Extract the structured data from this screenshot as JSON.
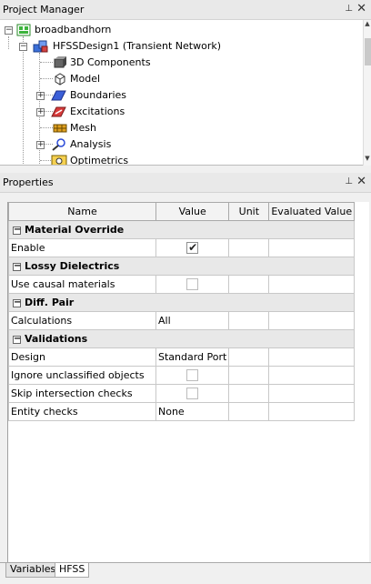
{
  "project_manager": {
    "title": "Project Manager",
    "pin_glyph": "ᵖ",
    "close_glyph": "✕",
    "tree": {
      "root": "broadbandhorn",
      "design": "HFSSDesign1 (Transient Network)",
      "children": [
        {
          "label": "3D Components",
          "icon": "components-icon"
        },
        {
          "label": "Model",
          "icon": "model-icon"
        },
        {
          "label": "Boundaries",
          "icon": "boundaries-icon"
        },
        {
          "label": "Excitations",
          "icon": "excitations-icon"
        },
        {
          "label": "Mesh",
          "icon": "mesh-icon"
        },
        {
          "label": "Analysis",
          "icon": "analysis-icon"
        },
        {
          "label": "Optimetrics",
          "icon": "optimetrics-icon"
        }
      ]
    }
  },
  "properties": {
    "title": "Properties",
    "columns": {
      "name": "Name",
      "value": "Value",
      "unit": "Unit",
      "evaluated": "Evaluated Value"
    },
    "groups": {
      "material_override": {
        "title": "Material Override",
        "rows": {
          "enable": {
            "name": "Enable",
            "checked": true
          }
        }
      },
      "lossy_dielectrics": {
        "title": "Lossy Dielectrics",
        "rows": {
          "causal": {
            "name": "Use causal materials",
            "checked": false
          }
        }
      },
      "diff_pair": {
        "title": "Diff. Pair",
        "rows": {
          "calculations": {
            "name": "Calculations",
            "value": "All"
          }
        }
      },
      "validations": {
        "title": "Validations",
        "rows": {
          "design": {
            "name": "Design",
            "value": "Standard Port"
          },
          "ignore": {
            "name": "Ignore unclassified objects",
            "checked": false
          },
          "skip": {
            "name": "Skip intersection checks",
            "checked": false
          },
          "entity": {
            "name": "Entity checks",
            "value": "None"
          }
        }
      }
    }
  },
  "tabs": {
    "variables": "Variables",
    "hfss": "HFSS"
  }
}
